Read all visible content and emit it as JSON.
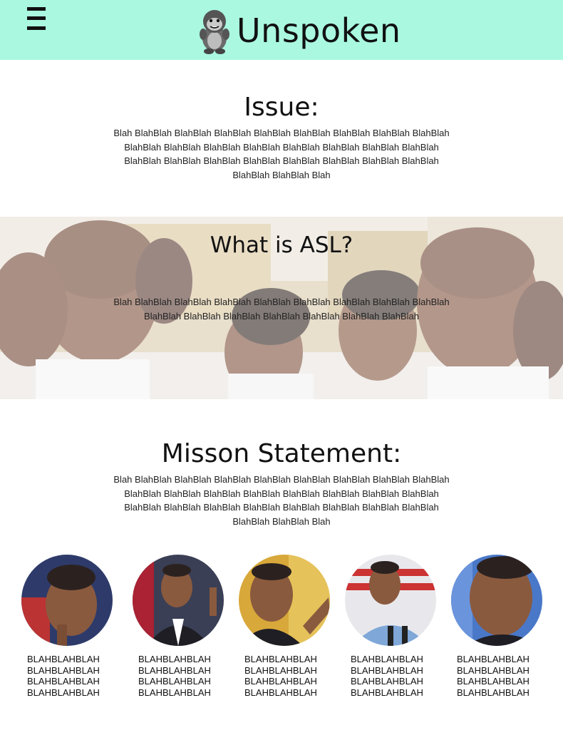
{
  "header": {
    "title": "Unspoken",
    "menu_icon": "hamburger-menu-icon",
    "logo_icon": "gorilla-logo-icon",
    "background": "#aaf8e0"
  },
  "issue": {
    "heading": "Issue:",
    "body": "Blah BlahBlah BlahBlah BlahBlah BlahBlah BlahBlah BlahBlah BlahBlah BlahBlah BlahBlah BlahBlah BlahBlah BlahBlah BlahBlah BlahBlah BlahBlah BlahBlah BlahBlah BlahBlah BlahBlah BlahBlah BlahBlah BlahBlah BlahBlah BlahBlah BlahBlah BlahBlah Blah"
  },
  "asl": {
    "heading": "What is ASL?",
    "body": "Blah BlahBlah BlahBlah BlahBlah BlahBlah BlahBlah BlahBlah BlahBlah BlahBlah BlahBlah BlahBlah BlahBlah BlahBlah BlahBlah BlahBlah BlahBlah"
  },
  "mission": {
    "heading": "Misson Statement:",
    "body": "Blah BlahBlah BlahBlah BlahBlah BlahBlah BlahBlah BlahBlah BlahBlah BlahBlah BlahBlah BlahBlah BlahBlah BlahBlah BlahBlah BlahBlah BlahBlah BlahBlah BlahBlah BlahBlah BlahBlah BlahBlah BlahBlah BlahBlah BlahBlah BlahBlah BlahBlah BlahBlah Blah"
  },
  "team": [
    {
      "lines": [
        "BLAHBLAHBLAH",
        "BLAHBLAHBLAH",
        "BLAHBLAHBLAH",
        "BLAHBLAHBLAH"
      ]
    },
    {
      "lines": [
        "BLAHBLAHBLAH",
        "BLAHBLAHBLAH",
        "BLAHBLAHBLAH",
        "BLAHBLAHBLAH"
      ]
    },
    {
      "lines": [
        "BLAHBLAHBLAH",
        "BLAHBLAHBLAH",
        "BLAHBLAHBLAH",
        "BLAHBLAHBLAH"
      ]
    },
    {
      "lines": [
        "BLAHBLAHBLAH",
        "BLAHBLAHBLAH",
        "BLAHBLAHBLAH",
        "BLAHBLAHBLAH"
      ]
    },
    {
      "lines": [
        "BLAHBLAHBLAH",
        "BLAHBLAHBLAH",
        "BLAHBLAHBLAH",
        "BLAHBLAHBLAH"
      ]
    }
  ]
}
